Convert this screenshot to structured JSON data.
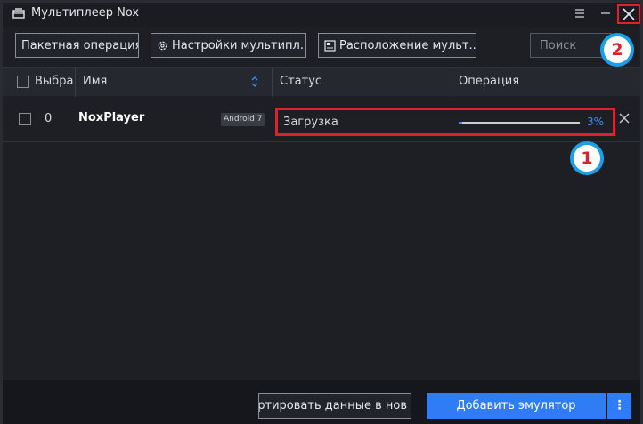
{
  "window": {
    "title": "Мультиплеер Nox"
  },
  "toolbar": {
    "batch_label": "Пакетная операция",
    "settings_label": "Настройки мультипл...",
    "layout_label": "Расположение мульт...",
    "search_placeholder": "Поиск"
  },
  "table": {
    "columns": {
      "select": "Выбра",
      "name": "Имя",
      "status": "Статус",
      "operation": "Операция"
    },
    "rows": [
      {
        "index": "0",
        "name": "NoxPlayer",
        "version": "Android 7",
        "status": "Загрузка",
        "progress_percent": 3,
        "progress_label": "3%"
      }
    ]
  },
  "footer": {
    "export_label": "ортировать данные в нов",
    "add_label": "Добавить эмулятор",
    "more_label": "⋮"
  },
  "annotations": {
    "marker1": "1",
    "marker2": "2"
  },
  "colors": {
    "accent": "#2f7df6",
    "highlight": "#e0202a",
    "marker_ring": "#1aa0e8"
  }
}
